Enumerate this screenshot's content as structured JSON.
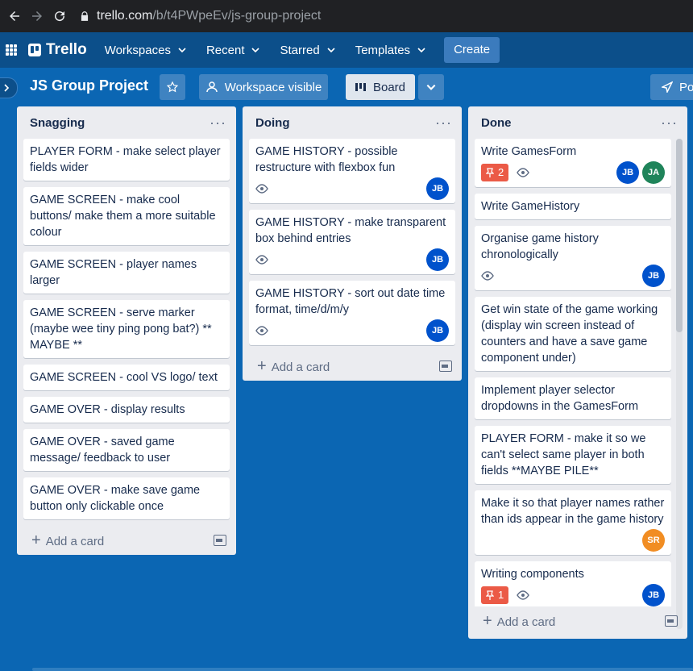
{
  "browser": {
    "domain": "trello.com",
    "path": "/b/t4PWpeEv/js-group-project"
  },
  "app": {
    "logo": "Trello",
    "menus": [
      "Workspaces",
      "Recent",
      "Starred",
      "Templates"
    ],
    "create": "Create"
  },
  "board": {
    "title": "JS Group Project",
    "visibility": "Workspace visible",
    "view": "Board",
    "power_ups": "Po"
  },
  "lists": [
    {
      "title": "Snagging",
      "cards": [
        {
          "text": "PLAYER FORM - make select player fields wider"
        },
        {
          "text": "GAME SCREEN - make cool buttons/ make them a more suitable colour"
        },
        {
          "text": "GAME SCREEN - player names larger"
        },
        {
          "text": "GAME SCREEN - serve marker (maybe wee tiny ping pong bat?) ** MAYBE **"
        },
        {
          "text": "GAME SCREEN - cool VS logo/ text"
        },
        {
          "text": "GAME OVER - display results"
        },
        {
          "text": "GAME OVER - saved game message/ feedback to user"
        },
        {
          "text": "GAME OVER - make save game button only clickable once"
        }
      ],
      "add_label": "Add a card"
    },
    {
      "title": "Doing",
      "cards": [
        {
          "text": "GAME HISTORY - possible restructure with flexbox fun",
          "watch": true,
          "members": [
            "JB"
          ]
        },
        {
          "text": "GAME HISTORY - make transparent box behind entries",
          "watch": true,
          "members": [
            "JB"
          ]
        },
        {
          "text": "GAME HISTORY - sort out date time format, time/d/m/y",
          "watch": true,
          "members": [
            "JB"
          ]
        }
      ],
      "add_label": "Add a card"
    },
    {
      "title": "Done",
      "cards": [
        {
          "text": "Write GamesForm",
          "pins": "2",
          "watch": true,
          "members": [
            "JB",
            "JA"
          ]
        },
        {
          "text": "Write GameHistory"
        },
        {
          "text": "Organise game history chronologically",
          "watch": true,
          "members": [
            "JB"
          ]
        },
        {
          "text": "Get win state of the game working (display win screen instead of counters and have a save game component under)"
        },
        {
          "text": "Implement player selector dropdowns in the GamesForm"
        },
        {
          "text": "PLAYER FORM - make it so we can't select same player in both fields **MAYBE PILE**"
        },
        {
          "text": "Make it so that player names rather than ids appear in the game history",
          "members": [
            "SR"
          ]
        },
        {
          "text": "Writing components",
          "pins": "1",
          "watch": true,
          "members": [
            "JB"
          ]
        }
      ],
      "add_label": "Add a card"
    }
  ],
  "colors": {
    "board_bg": "#0b66b3",
    "header_bg": "#0c4f8a",
    "JB": "#0052cc",
    "JA": "#1f845a",
    "SR": "#f18d23",
    "pin": "#eb5a46"
  }
}
